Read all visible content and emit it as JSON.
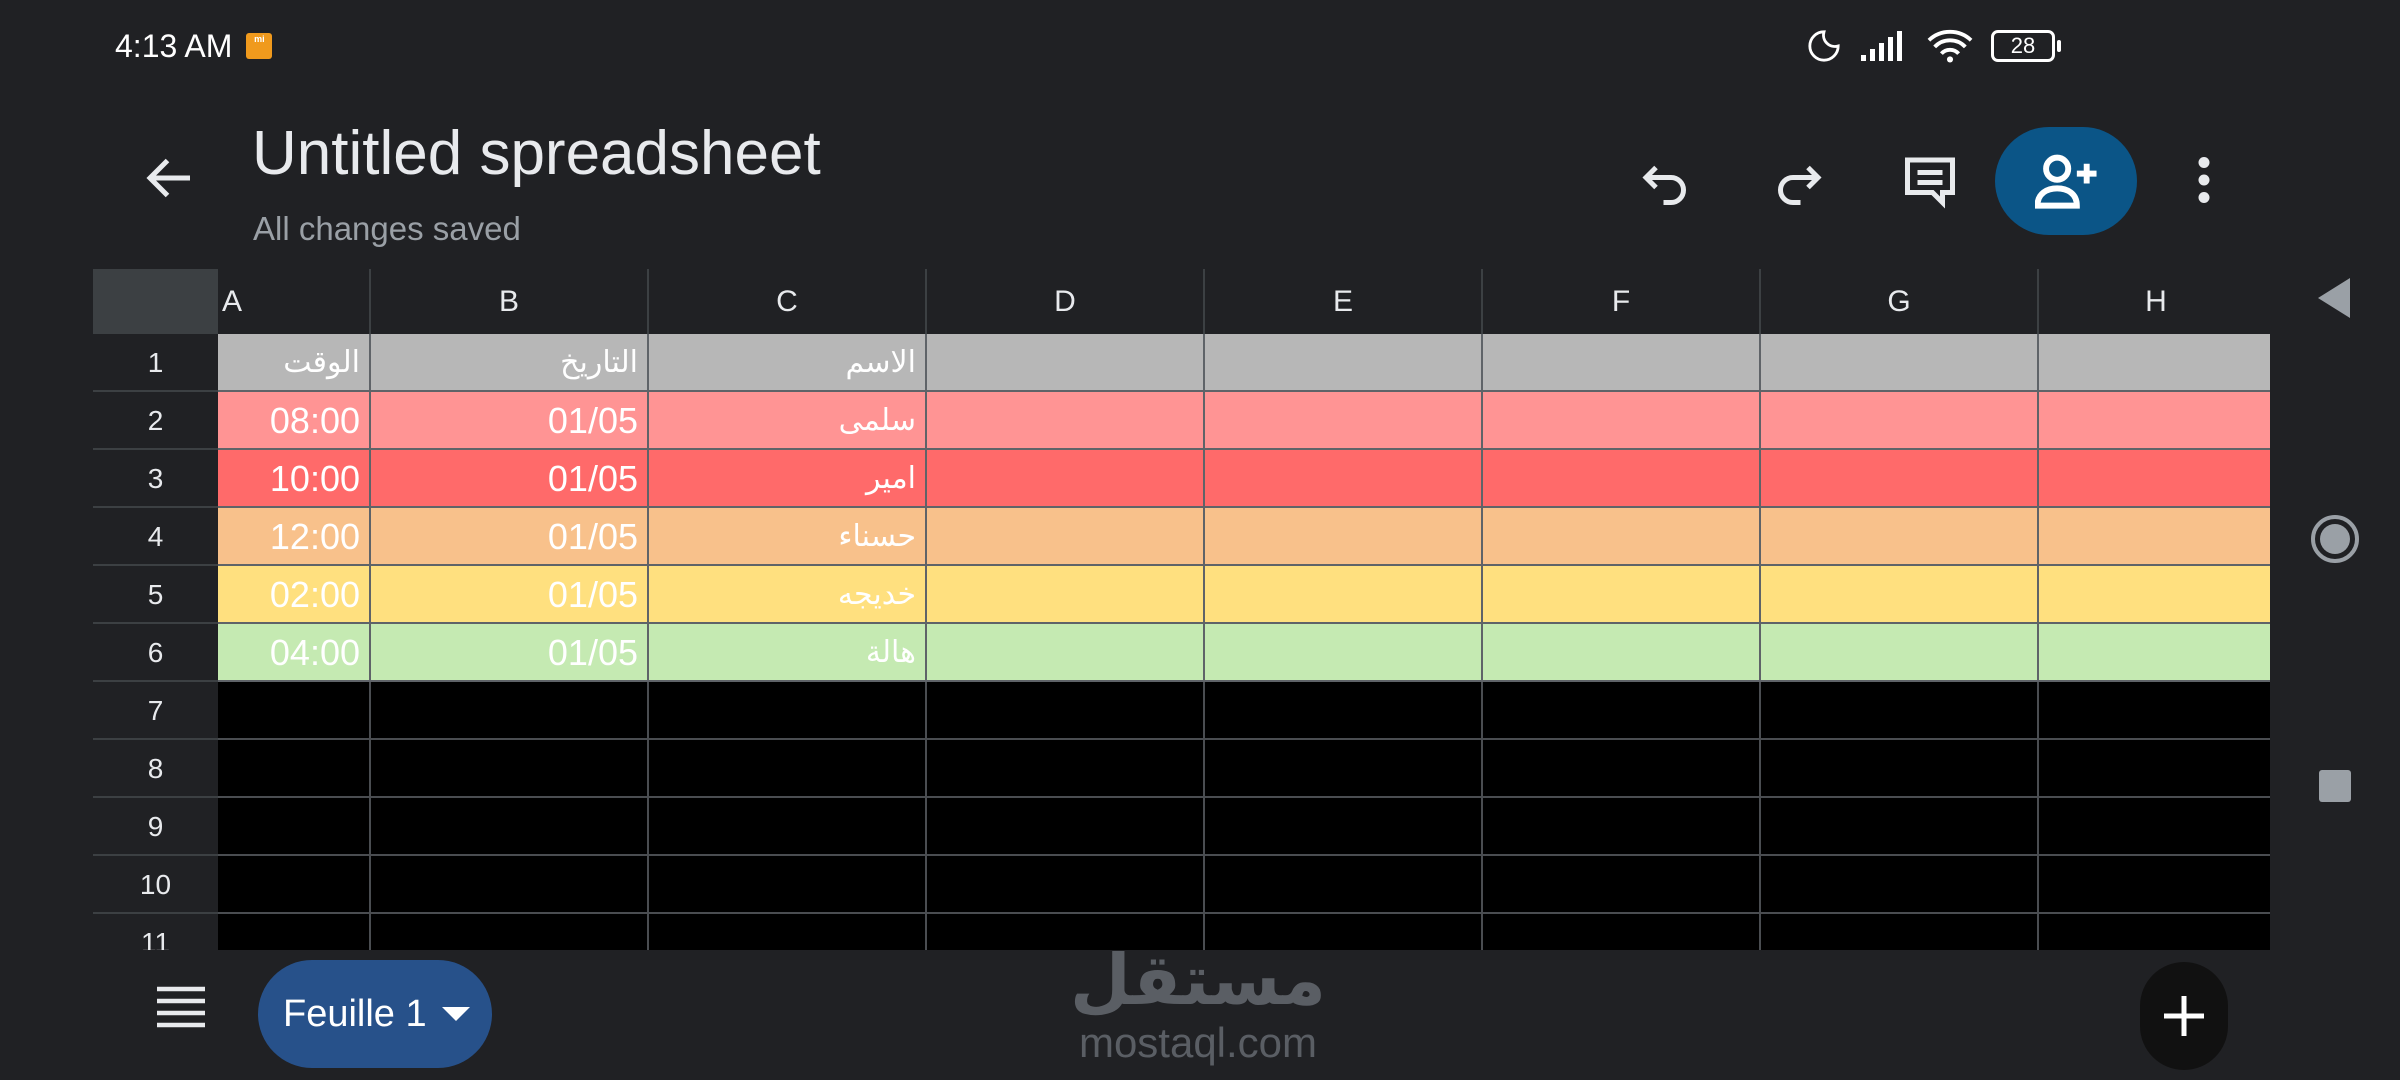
{
  "status_bar": {
    "time": "4:13 AM",
    "battery": "28"
  },
  "header": {
    "title": "Untitled spreadsheet",
    "save_status": "All changes saved"
  },
  "colors": {
    "share_button": "#0b5587",
    "sheet_tab": "#27518a"
  },
  "grid": {
    "columns": [
      "A",
      "B",
      "C",
      "D",
      "E",
      "F",
      "G",
      "H"
    ],
    "rows": [
      "1",
      "2",
      "3",
      "4",
      "5",
      "6",
      "7",
      "8",
      "9",
      "10",
      "11"
    ],
    "data": [
      {
        "a": "الوقت",
        "b": "التاريخ",
        "c": "الاسم",
        "fill": "#b7b7b7"
      },
      {
        "a": "08:00",
        "b": "01/05",
        "c": "سلمى",
        "fill": "#ff9494"
      },
      {
        "a": "10:00",
        "b": "01/05",
        "c": "امير",
        "fill": "#ff6a6a"
      },
      {
        "a": "12:00",
        "b": "01/05",
        "c": "حسناء",
        "fill": "#f8c18b"
      },
      {
        "a": "02:00",
        "b": "01/05",
        "c": "خديجه",
        "fill": "#ffe07f"
      },
      {
        "a": "04:00",
        "b": "01/05",
        "c": "هالة",
        "fill": "#c5eab2"
      }
    ]
  },
  "bottom_bar": {
    "sheet_tab": "Feuille 1"
  },
  "watermark": {
    "arabic": "مستقل",
    "latin": "mostaql.com"
  }
}
